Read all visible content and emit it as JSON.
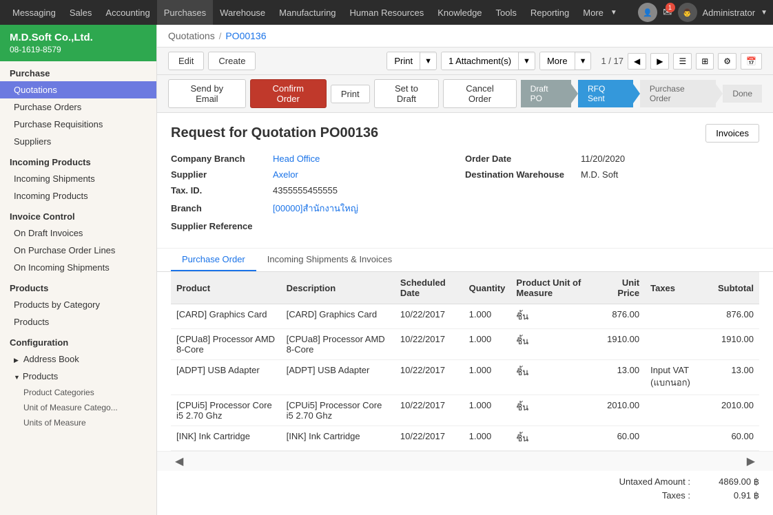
{
  "topnav": {
    "items": [
      {
        "label": "Messaging",
        "active": false
      },
      {
        "label": "Sales",
        "active": false
      },
      {
        "label": "Accounting",
        "active": false
      },
      {
        "label": "Purchases",
        "active": true
      },
      {
        "label": "Warehouse",
        "active": false
      },
      {
        "label": "Manufacturing",
        "active": false
      },
      {
        "label": "Human Resources",
        "active": false
      },
      {
        "label": "Knowledge",
        "active": false
      },
      {
        "label": "Tools",
        "active": false
      },
      {
        "label": "Reporting",
        "active": false
      },
      {
        "label": "More",
        "active": false
      }
    ],
    "admin_label": "Administrator",
    "mail_badge": "1"
  },
  "sidebar": {
    "logo": {
      "company_name": "M.D.Soft Co.,Ltd.",
      "company_phone": "08-1619-8579"
    },
    "sections": [
      {
        "header": "Purchase",
        "items": [
          {
            "label": "Quotations",
            "active": true,
            "indent": 1
          },
          {
            "label": "Purchase Orders",
            "active": false,
            "indent": 1
          },
          {
            "label": "Purchase Requisitions",
            "active": false,
            "indent": 1
          },
          {
            "label": "Suppliers",
            "active": false,
            "indent": 1
          }
        ]
      },
      {
        "header": "Incoming Products",
        "items": [
          {
            "label": "Incoming Shipments",
            "active": false,
            "indent": 1
          },
          {
            "label": "Incoming Products",
            "active": false,
            "indent": 1
          }
        ]
      },
      {
        "header": "Invoice Control",
        "items": [
          {
            "label": "On Draft Invoices",
            "active": false,
            "indent": 1
          },
          {
            "label": "On Purchase Order Lines",
            "active": false,
            "indent": 1
          },
          {
            "label": "On Incoming Shipments",
            "active": false,
            "indent": 1
          }
        ]
      },
      {
        "header": "Products",
        "items": [
          {
            "label": "Products by Category",
            "active": false,
            "indent": 1
          },
          {
            "label": "Products",
            "active": false,
            "indent": 1
          }
        ]
      },
      {
        "header": "Configuration",
        "items": [
          {
            "label": "Address Book",
            "active": false,
            "indent": 1,
            "has_arrow": true
          },
          {
            "label": "Products",
            "active": false,
            "indent": 1,
            "has_arrow": true
          },
          {
            "label": "Product Categories",
            "active": false,
            "indent": 2
          },
          {
            "label": "Unit of Measure Catego...",
            "active": false,
            "indent": 2
          },
          {
            "label": "Units of Measure",
            "active": false,
            "indent": 2
          }
        ]
      }
    ]
  },
  "breadcrumb": {
    "parent": "Quotations",
    "current": "PO00136"
  },
  "toolbar": {
    "edit_label": "Edit",
    "create_label": "Create",
    "print_label": "Print",
    "attachment_label": "1 Attachment(s)",
    "more_label": "More",
    "page_info": "1 / 17"
  },
  "action_bar": {
    "send_email_label": "Send by Email",
    "confirm_order_label": "Confirm Order",
    "print_label": "Print",
    "set_to_draft_label": "Set to Draft",
    "cancel_order_label": "Cancel Order"
  },
  "pipeline": {
    "steps": [
      {
        "label": "Draft PO",
        "state": "done"
      },
      {
        "label": "RFQ Sent",
        "state": "active"
      },
      {
        "label": "Purchase Order",
        "state": "pending"
      },
      {
        "label": "Done",
        "state": "pending"
      }
    ]
  },
  "form": {
    "title": "Request for Quotation PO00136",
    "invoices_label": "Invoices",
    "fields_left": [
      {
        "label": "Company Branch",
        "value": "Head Office",
        "link": true
      },
      {
        "label": "Supplier",
        "value": "Axelor",
        "link": true
      },
      {
        "label": "Tax. ID.",
        "value": "4355555455555",
        "link": false
      },
      {
        "label": "Branch",
        "value": "[00000]สำนักงานใหญ่",
        "link": true
      },
      {
        "label": "Supplier Reference",
        "value": "",
        "link": false
      }
    ],
    "fields_right": [
      {
        "label": "Order Date",
        "value": "11/20/2020",
        "link": false
      },
      {
        "label": "Destination Warehouse",
        "value": "M.D. Soft",
        "link": false
      }
    ]
  },
  "tabs": [
    {
      "label": "Purchase Order",
      "active": true
    },
    {
      "label": "Incoming Shipments & Invoices",
      "active": false
    }
  ],
  "table": {
    "headers": [
      "Product",
      "Description",
      "Scheduled Date",
      "Quantity",
      "Product Unit of Measure",
      "Unit Price",
      "Taxes",
      "Subtotal"
    ],
    "rows": [
      {
        "product": "[CARD] Graphics Card",
        "description": "[CARD] Graphics Card",
        "scheduled_date": "10/22/2017",
        "quantity": "1.000",
        "uom": "ชิ้น",
        "unit_price": "876.00",
        "taxes": "",
        "subtotal": "876.00"
      },
      {
        "product": "[CPUa8] Processor AMD 8-Core",
        "description": "[CPUa8] Processor AMD 8-Core",
        "scheduled_date": "10/22/2017",
        "quantity": "1.000",
        "uom": "ชิ้น",
        "unit_price": "1910.00",
        "taxes": "",
        "subtotal": "1910.00"
      },
      {
        "product": "[ADPT] USB Adapter",
        "description": "[ADPT] USB Adapter",
        "scheduled_date": "10/22/2017",
        "quantity": "1.000",
        "uom": "ชิ้น",
        "unit_price": "13.00",
        "taxes": "Input VAT (แบกนอก)",
        "subtotal": "13.00"
      },
      {
        "product": "[CPUi5] Processor Core i5 2.70 Ghz",
        "description": "[CPUi5] Processor Core i5 2.70 Ghz",
        "scheduled_date": "10/22/2017",
        "quantity": "1.000",
        "uom": "ชิ้น",
        "unit_price": "2010.00",
        "taxes": "",
        "subtotal": "2010.00"
      },
      {
        "product": "[INK] Ink Cartridge",
        "description": "[INK] Ink Cartridge",
        "scheduled_date": "10/22/2017",
        "quantity": "1.000",
        "uom": "ชิ้น",
        "unit_price": "60.00",
        "taxes": "",
        "subtotal": "60.00"
      }
    ]
  },
  "totals": {
    "untaxed_label": "Untaxed Amount :",
    "untaxed_value": "4869.00 ฿",
    "taxes_label": "Taxes :",
    "taxes_value": "0.91 ฿"
  }
}
